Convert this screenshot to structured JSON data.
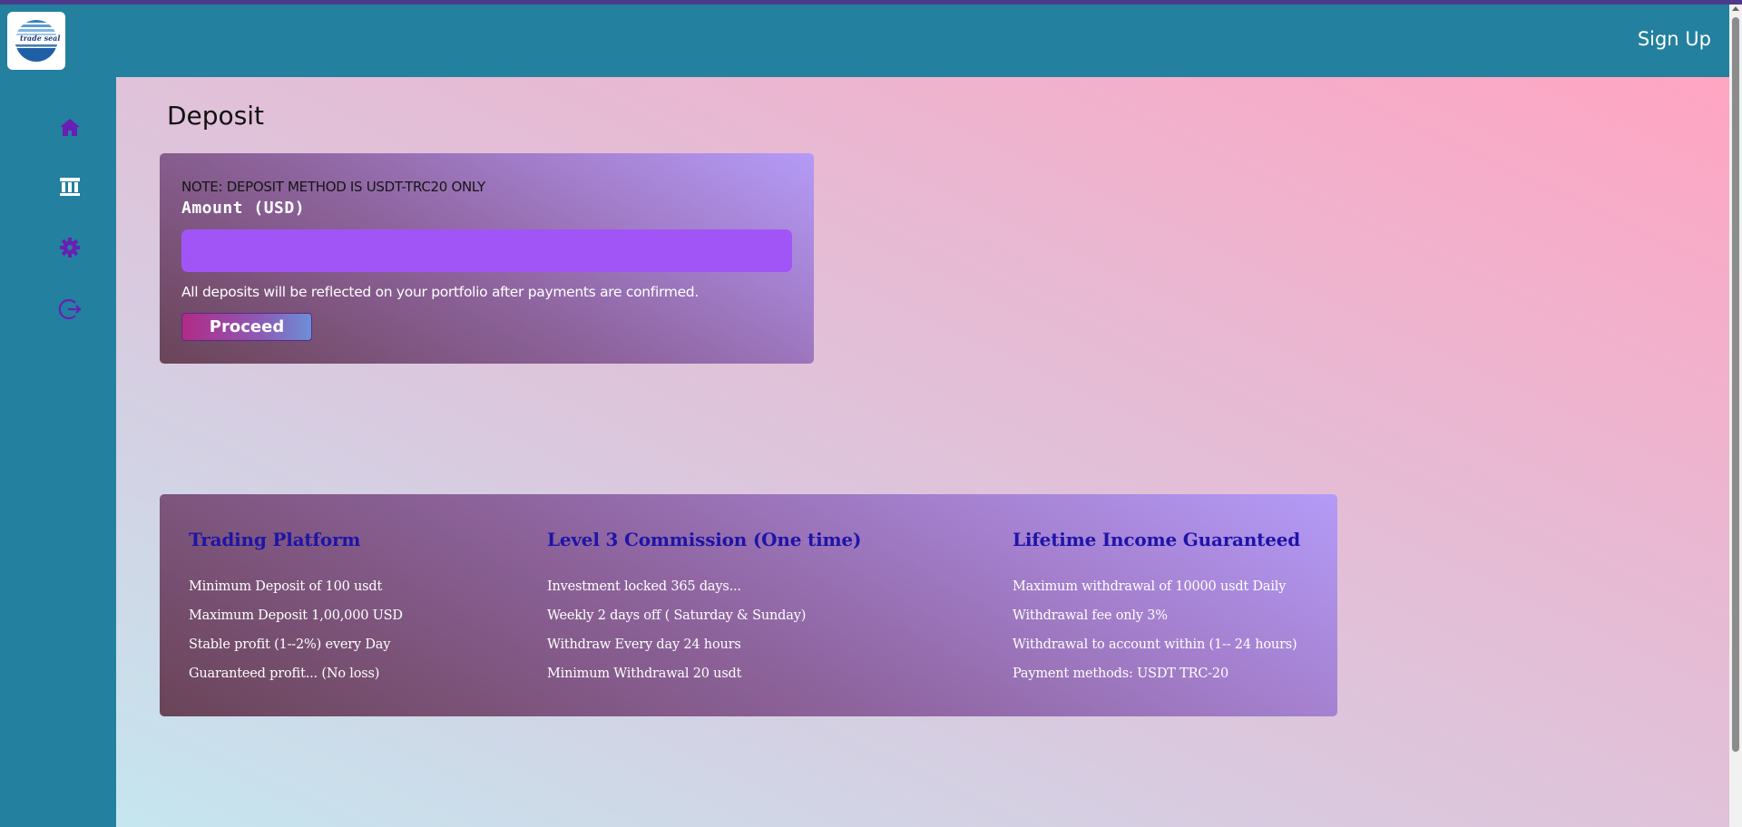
{
  "header": {
    "logo_text": "trade seal",
    "signup_label": "Sign Up"
  },
  "sidebar": {
    "items": [
      {
        "icon": "home-icon"
      },
      {
        "icon": "bank-icon"
      },
      {
        "icon": "gear-icon"
      },
      {
        "icon": "logout-icon"
      }
    ],
    "icon_color": "#6a1fb4"
  },
  "page": {
    "title": "Deposit"
  },
  "deposit": {
    "note": "NOTE: DEPOSIT METHOD IS USDT-TRC20 ONLY",
    "amount_label": "Amount (USD)",
    "amount_value": "",
    "info": "All deposits will be reflected on your portfolio after payments are confirmed.",
    "proceed_label": "Proceed"
  },
  "info": {
    "columns": [
      {
        "title": "Trading Platform",
        "items": [
          "Minimum Deposit of 100 usdt",
          "Maximum Deposit 1,00,000 USD",
          "Stable profit (1--2%) every Day",
          "Guaranteed profit... (No loss)"
        ]
      },
      {
        "title": "Level 3 Commission (One time)",
        "items": [
          "Investment locked 365 days...",
          "Weekly 2 days off ( Saturday & Sunday)",
          "Withdraw Every day 24 hours",
          "Minimum Withdrawal 20 usdt"
        ]
      },
      {
        "title": "Lifetime Income Guaranteed",
        "items": [
          "Maximum withdrawal of 10000 usdt Daily",
          "Withdrawal fee only 3%",
          "Withdrawal to account within (1-- 24 hours)",
          "Payment methods: USDT TRC-20"
        ]
      }
    ]
  },
  "colors": {
    "header_bg": "#23809f",
    "heading_blue": "#1e14a8",
    "input_purple": "#a155f7"
  }
}
